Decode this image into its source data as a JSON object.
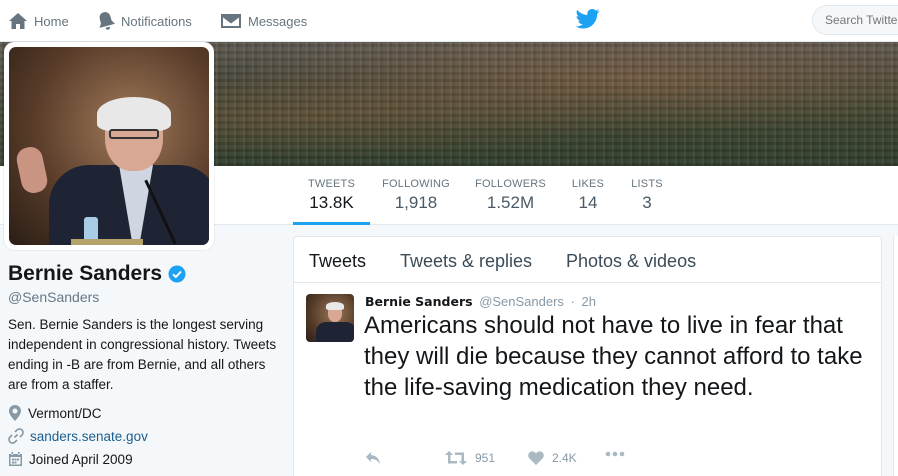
{
  "nav": {
    "home": "Home",
    "notifications": "Notifications",
    "messages": "Messages",
    "search_placeholder": "Search Twitter"
  },
  "stats": [
    {
      "label": "TWEETS",
      "value": "13.8K"
    },
    {
      "label": "FOLLOWING",
      "value": "1,918"
    },
    {
      "label": "FOLLOWERS",
      "value": "1.52M"
    },
    {
      "label": "LIKES",
      "value": "14"
    },
    {
      "label": "LISTS",
      "value": "3"
    }
  ],
  "profile": {
    "name": "Bernie Sanders",
    "handle": "@SenSanders",
    "bio": "Sen. Bernie Sanders is the longest serving independent in congressional history. Tweets ending in -B are from Bernie, and all others are from a staffer.",
    "location": "Vermont/DC",
    "website": "sanders.senate.gov",
    "joined": "Joined April 2009"
  },
  "tabs": [
    "Tweets",
    "Tweets & replies",
    "Photos & videos"
  ],
  "tweet": {
    "name": "Bernie Sanders",
    "handle": "@SenSanders",
    "time": "2h",
    "text": "Americans should not have to live in fear that they will die because they cannot afford to take the life-saving medication they need.",
    "retweets": "951",
    "likes": "2.4K"
  },
  "icons": [
    "home-icon",
    "bell-icon",
    "envelope-icon",
    "twitter-bird-icon",
    "verified-icon",
    "location-pin-icon",
    "link-icon",
    "calendar-icon",
    "reply-icon",
    "retweet-icon",
    "heart-icon",
    "more-icon"
  ],
  "colors": {
    "accent": "#1da1f2",
    "text": "#14171a",
    "muted": "#657786"
  }
}
